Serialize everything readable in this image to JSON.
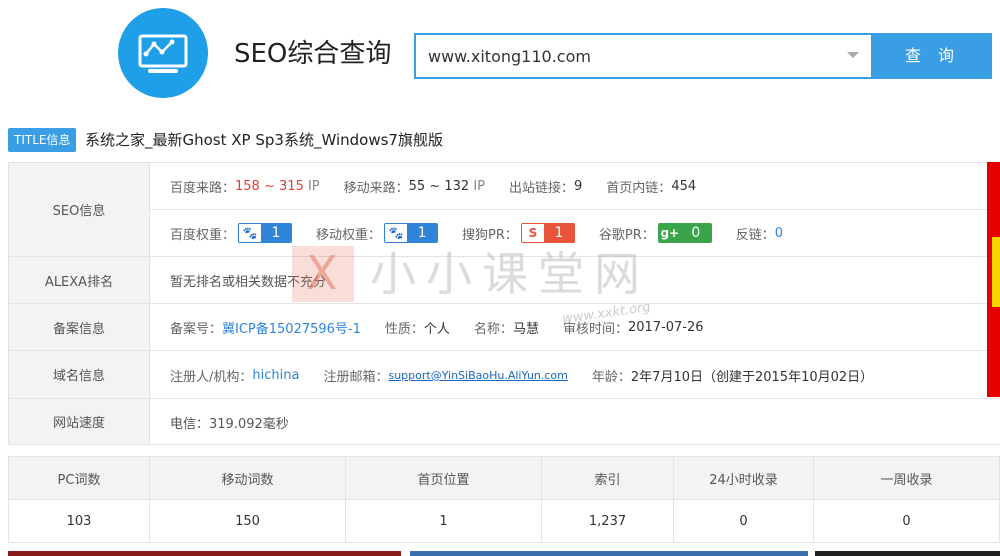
{
  "header": {
    "app_title": "SEO综合查询",
    "search_value": "www.xitong110.com",
    "search_button": "查 询"
  },
  "title_line": {
    "badge": "TITLE信息",
    "text": "系统之家_最新Ghost XP Sp3系统_Windows7旗舰版"
  },
  "seo": {
    "label": "SEO信息",
    "baidu_source_label": "百度来路：",
    "baidu_source_value": "158 ~ 315",
    "baidu_source_unit": "IP",
    "mobile_source_label": "移动来路：",
    "mobile_source_value": "55 ~ 132",
    "mobile_source_unit": "IP",
    "outbound_label": "出站链接：",
    "outbound_value": "9",
    "inner_label": "首页内链：",
    "inner_value": "454",
    "baidu_weight_label": "百度权重：",
    "baidu_weight_value": "1",
    "mobile_weight_label": "移动权重：",
    "mobile_weight_value": "1",
    "sogou_pr_label": "搜狗PR：",
    "sogou_pr_value": "1",
    "google_pr_label": "谷歌PR：",
    "google_pr_value": "0",
    "backlink_label": "反链：",
    "backlink_value": "0"
  },
  "alexa": {
    "label": "ALEXA排名",
    "text": "暂无排名或相关数据不充分"
  },
  "icp": {
    "label": "备案信息",
    "number_label": "备案号：",
    "number_value": "冀ICP备15027596号-1",
    "nature_label": "性质：",
    "nature_value": "个人",
    "name_label": "名称：",
    "name_value": "马慧",
    "date_label": "审核时间：",
    "date_value": "2017-07-26"
  },
  "domain": {
    "label": "域名信息",
    "registrar_label": "注册人/机构：",
    "registrar_value": "hichina",
    "email_label": "注册邮箱：",
    "email_value": "support@YinSiBaoHu.AliYun.com",
    "age_label": "年龄：",
    "age_value": "2年7月10日（创建于2015年10月02日）"
  },
  "speed": {
    "label": "网站速度",
    "text": "电信：319.092毫秒"
  },
  "watermark": {
    "mark": "X",
    "text": "小小课堂网",
    "url": "www.xxkt.org"
  },
  "keywords": {
    "headers": [
      "PC词数",
      "移动词数",
      "首页位置",
      "索引",
      "24小时收录",
      "一周收录"
    ],
    "values": [
      "103",
      "150",
      "1",
      "1,237",
      "0",
      "0"
    ]
  },
  "colors": {
    "accent": "#3a9ee4",
    "red": "#e53c3c",
    "link": "#2f84d8"
  }
}
